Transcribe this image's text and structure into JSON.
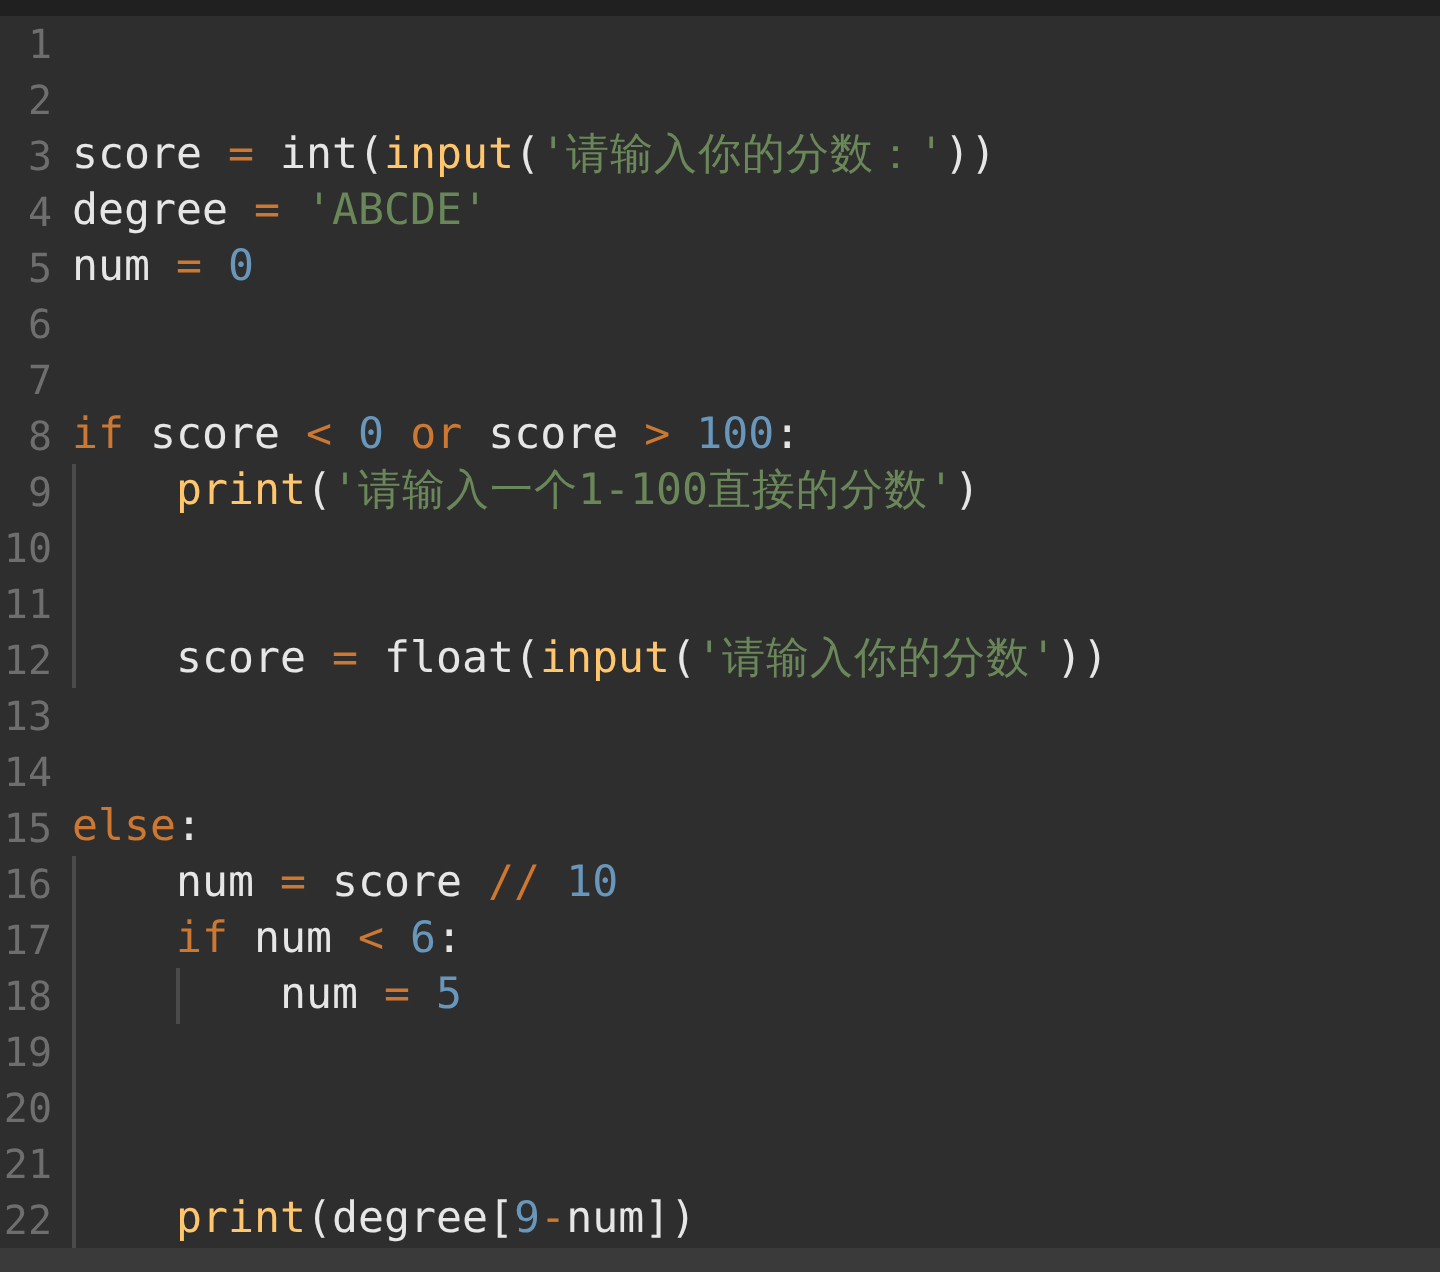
{
  "editor": {
    "lines": [
      {
        "number": "1"
      },
      {
        "number": "2"
      },
      {
        "number": "3",
        "tokens": [
          {
            "kind": "name",
            "text": "score "
          },
          {
            "kind": "op",
            "text": "= "
          },
          {
            "kind": "name",
            "text": "int("
          },
          {
            "kind": "fn",
            "text": "input"
          },
          {
            "kind": "punc",
            "text": "("
          },
          {
            "kind": "str",
            "text": "'请输入你的分数：'"
          },
          {
            "kind": "punc",
            "text": "))"
          }
        ]
      },
      {
        "number": "4",
        "tokens": [
          {
            "kind": "name",
            "text": "degree "
          },
          {
            "kind": "op",
            "text": "= "
          },
          {
            "kind": "str",
            "text": "'ABCDE'"
          }
        ]
      },
      {
        "number": "5",
        "tokens": [
          {
            "kind": "name",
            "text": "num "
          },
          {
            "kind": "op",
            "text": "= "
          },
          {
            "kind": "num",
            "text": "0"
          }
        ]
      },
      {
        "number": "6"
      },
      {
        "number": "7"
      },
      {
        "number": "8",
        "tokens": [
          {
            "kind": "kw",
            "text": "if "
          },
          {
            "kind": "name",
            "text": "score "
          },
          {
            "kind": "op",
            "text": "< "
          },
          {
            "kind": "num",
            "text": "0 "
          },
          {
            "kind": "kw",
            "text": "or "
          },
          {
            "kind": "name",
            "text": "score "
          },
          {
            "kind": "op",
            "text": "> "
          },
          {
            "kind": "num",
            "text": "100"
          },
          {
            "kind": "punc",
            "text": ":"
          }
        ],
        "children": [
          {
            "number": "9",
            "tokens": [
              {
                "kind": "fn",
                "text": "print"
              },
              {
                "kind": "punc",
                "text": "("
              },
              {
                "kind": "str",
                "text": "'请输入一个1-100直接的分数'"
              },
              {
                "kind": "punc",
                "text": ")"
              }
            ]
          },
          {
            "number": "10"
          },
          {
            "number": "11"
          },
          {
            "number": "12",
            "tokens": [
              {
                "kind": "name",
                "text": "score "
              },
              {
                "kind": "op",
                "text": "= "
              },
              {
                "kind": "name",
                "text": "float("
              },
              {
                "kind": "fn",
                "text": "input"
              },
              {
                "kind": "punc",
                "text": "("
              },
              {
                "kind": "str",
                "text": "'请输入你的分数'"
              },
              {
                "kind": "punc",
                "text": "))"
              }
            ]
          }
        ]
      },
      {
        "number": "13"
      },
      {
        "number": "14"
      },
      {
        "number": "15",
        "tokens": [
          {
            "kind": "kw",
            "text": "else"
          },
          {
            "kind": "punc",
            "text": ":"
          }
        ],
        "children": [
          {
            "number": "16",
            "tokens": [
              {
                "kind": "name",
                "text": "num "
              },
              {
                "kind": "op",
                "text": "= "
              },
              {
                "kind": "name",
                "text": "score "
              },
              {
                "kind": "op",
                "text": "// "
              },
              {
                "kind": "num",
                "text": "10"
              }
            ]
          },
          {
            "number": "17",
            "tokens": [
              {
                "kind": "kw",
                "text": "if "
              },
              {
                "kind": "name",
                "text": "num "
              },
              {
                "kind": "op",
                "text": "< "
              },
              {
                "kind": "num",
                "text": "6"
              },
              {
                "kind": "punc",
                "text": ":"
              }
            ],
            "children": [
              {
                "number": "18",
                "tokens": [
                  {
                    "kind": "name",
                    "text": "num "
                  },
                  {
                    "kind": "op",
                    "text": "= "
                  },
                  {
                    "kind": "num",
                    "text": "5"
                  }
                ]
              }
            ]
          },
          {
            "number": "19"
          },
          {
            "number": "20"
          },
          {
            "number": "21"
          },
          {
            "number": "22",
            "tokens": [
              {
                "kind": "fn",
                "text": "print"
              },
              {
                "kind": "punc",
                "text": "(degree["
              },
              {
                "kind": "num",
                "text": "9"
              },
              {
                "kind": "op",
                "text": "-"
              },
              {
                "kind": "name",
                "text": "num"
              },
              {
                "kind": "punc",
                "text": "])"
              }
            ]
          }
        ]
      }
    ]
  }
}
